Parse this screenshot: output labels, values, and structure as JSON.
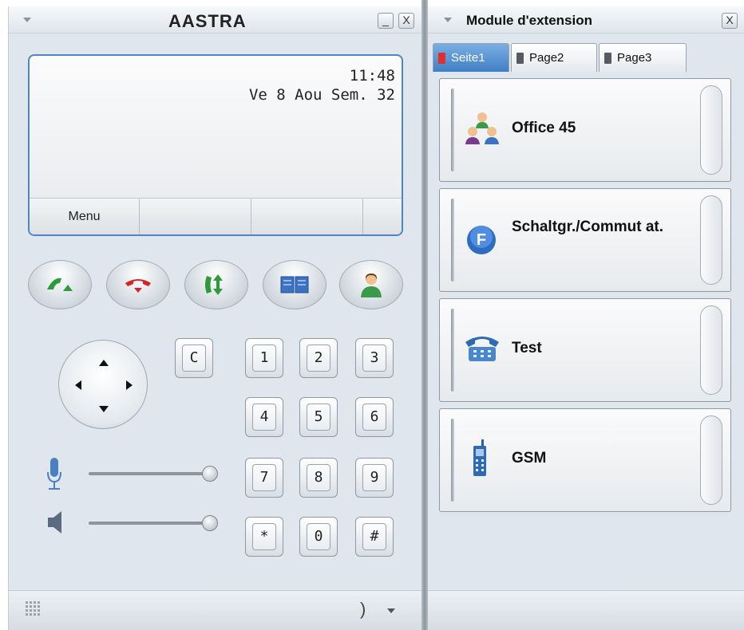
{
  "phone": {
    "brand": "AASTRA",
    "minimize_label": "_",
    "close_label": "X",
    "display": {
      "time": "11:48",
      "date_line": "Ve 8 Aou Sem. 32",
      "softkeys": [
        "Menu",
        "",
        "",
        ""
      ]
    },
    "function_buttons": [
      "off-hook-icon",
      "hang-up-icon",
      "transfer-icon",
      "phonebook-icon",
      "user-icon"
    ],
    "clear_key": "C",
    "keypad": [
      "1",
      "2",
      "3",
      "4",
      "5",
      "6",
      "7",
      "8",
      "9",
      "*",
      "0",
      "#"
    ],
    "sliders": {
      "microphone_level": 1.0,
      "speaker_level": 1.0
    },
    "status_bar": {
      "handset_symbol": ")"
    }
  },
  "module": {
    "title": "Module d'extension",
    "close_label": "X",
    "tabs": [
      {
        "label": "Seite1",
        "active": true,
        "color": "#e0302c"
      },
      {
        "label": "Page2",
        "active": false,
        "color": "#555b61"
      },
      {
        "label": "Page3",
        "active": false,
        "color": "#555b61"
      }
    ],
    "buttons": [
      {
        "label": "Office 45",
        "icon": "group-icon"
      },
      {
        "label": "Schaltgr./Commut at.",
        "icon": "switch-group-icon"
      },
      {
        "label": "Test",
        "icon": "desk-phone-icon"
      },
      {
        "label": "GSM",
        "icon": "mobile-phone-icon"
      }
    ]
  },
  "colors": {
    "accent": "#4d87c2",
    "tab_active": "#3f7fc5",
    "window_bg": "#dfe6ee"
  }
}
